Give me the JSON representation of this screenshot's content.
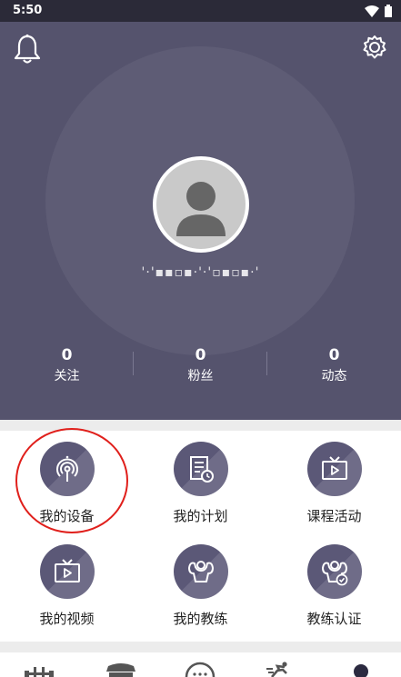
{
  "status_bar": {
    "time": "5:50",
    "wifi_icon": "wifi-icon",
    "battery_icon": "battery-icon"
  },
  "header": {
    "bell_icon": "bell-icon",
    "settings_icon": "gear-icon",
    "avatar_icon": "person-icon",
    "username": "'·'▪▪▫▪·'·'▫▪▫▪·'"
  },
  "stats": [
    {
      "value": "0",
      "label": "关注"
    },
    {
      "value": "0",
      "label": "粉丝"
    },
    {
      "value": "0",
      "label": "动态"
    }
  ],
  "menu": [
    {
      "label": "我的设备",
      "icon": "device-signal-icon",
      "highlighted": true
    },
    {
      "label": "我的计划",
      "icon": "plan-document-icon"
    },
    {
      "label": "课程活动",
      "icon": "tv-play-icon"
    },
    {
      "label": "我的视频",
      "icon": "tv-play-icon"
    },
    {
      "label": "我的教练",
      "icon": "coach-muscle-icon"
    },
    {
      "label": "教练认证",
      "icon": "coach-certified-icon"
    }
  ],
  "colors": {
    "header_bg": "#55536d",
    "icon_bg": "#5b5877",
    "highlight": "#e0201c"
  },
  "tabbar": [
    {
      "icon": "barbell-icon"
    },
    {
      "icon": "store-icon"
    },
    {
      "icon": "chat-icon"
    },
    {
      "icon": "running-icon"
    },
    {
      "icon": "profile-dot-icon"
    }
  ]
}
